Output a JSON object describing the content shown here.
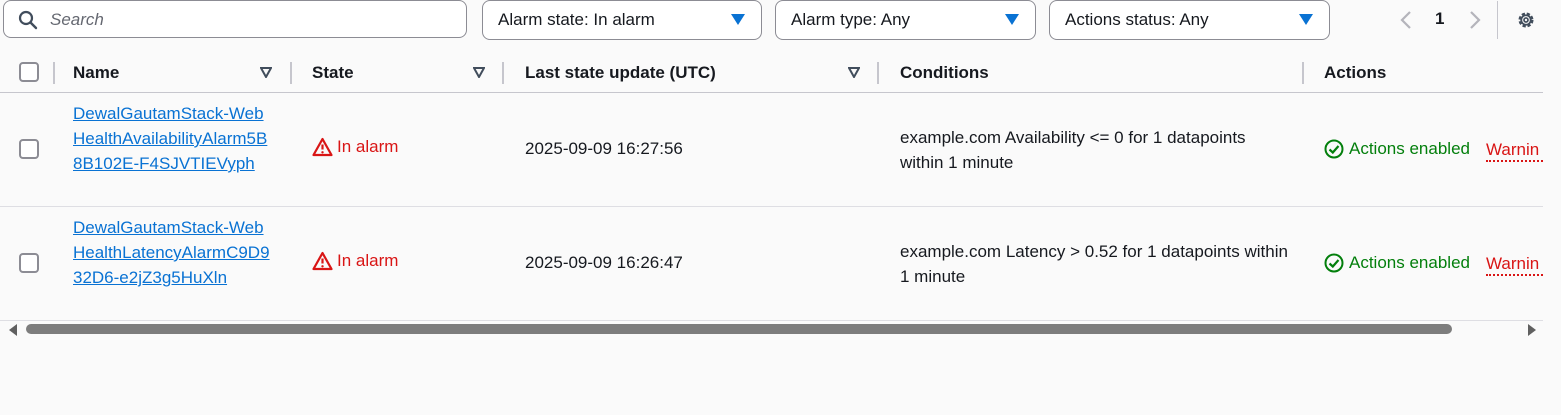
{
  "search": {
    "placeholder": "Search"
  },
  "filters": [
    {
      "label": "Alarm state: In alarm"
    },
    {
      "label": "Alarm type: Any"
    },
    {
      "label": "Actions status: Any"
    }
  ],
  "pagination": {
    "current_page": "1"
  },
  "table": {
    "columns": [
      "Name",
      "State",
      "Last state update (UTC)",
      "Conditions",
      "Actions"
    ],
    "rows": [
      {
        "name": "DewalGautamStack-WebHealthAvailabilityAlarm5B8B102E-F4SJVTIEVyph",
        "state": "In alarm",
        "last_update": "2025-09-09 16:27:56",
        "condition": "example.com Availability <= 0 for 1 datapoints within 1 minute",
        "actions_status": "Actions enabled",
        "warning": "Warnin"
      },
      {
        "name": "DewalGautamStack-WebHealthLatencyAlarmC9D932D6-e2jZ3g5HuXln",
        "state": "In alarm",
        "last_update": "2025-09-09 16:26:47",
        "condition": "example.com Latency > 0.52 for 1 datapoints within 1 minute",
        "actions_status": "Actions enabled",
        "warning": "Warnin"
      }
    ]
  },
  "colors": {
    "link": "#0972d3",
    "alarm": "#d91515",
    "success": "#037f0c",
    "caret": "#0972d3"
  },
  "icons": {
    "search": "search-icon",
    "caret": "caret-down-icon",
    "sort": "sort-icon",
    "alarm": "warning-triangle-icon",
    "enabled": "check-circle-icon",
    "settings": "gear-icon"
  }
}
